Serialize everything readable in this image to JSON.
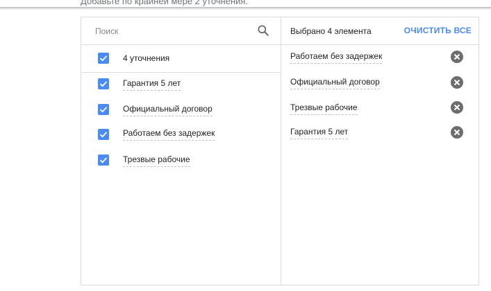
{
  "hint": "Добавьте по крайней мере 2 уточнения.",
  "search": {
    "placeholder": "Поиск"
  },
  "left": {
    "select_all_label": "4 уточнения",
    "options": [
      {
        "label": "Гарантия 5 лет",
        "checked": true
      },
      {
        "label": "Официальный договор",
        "checked": true
      },
      {
        "label": "Работаем без задержек",
        "checked": true
      },
      {
        "label": "Трезвые рабочие",
        "checked": true
      }
    ]
  },
  "right": {
    "selected_count": "Выбрано 4 элемента",
    "clear_all": "ОЧИСТИТЬ ВСЕ",
    "selected": [
      {
        "label": "Работаем без задержек"
      },
      {
        "label": "Официальный договор"
      },
      {
        "label": "Трезвые рабочие"
      },
      {
        "label": "Гарантия 5 лет"
      }
    ]
  },
  "colors": {
    "accent": "#4a8af4",
    "remove_icon": "#6d6d6d"
  },
  "icons": {
    "search": "search-icon",
    "checkbox": "checkmark-icon",
    "remove": "close-circle-icon"
  }
}
